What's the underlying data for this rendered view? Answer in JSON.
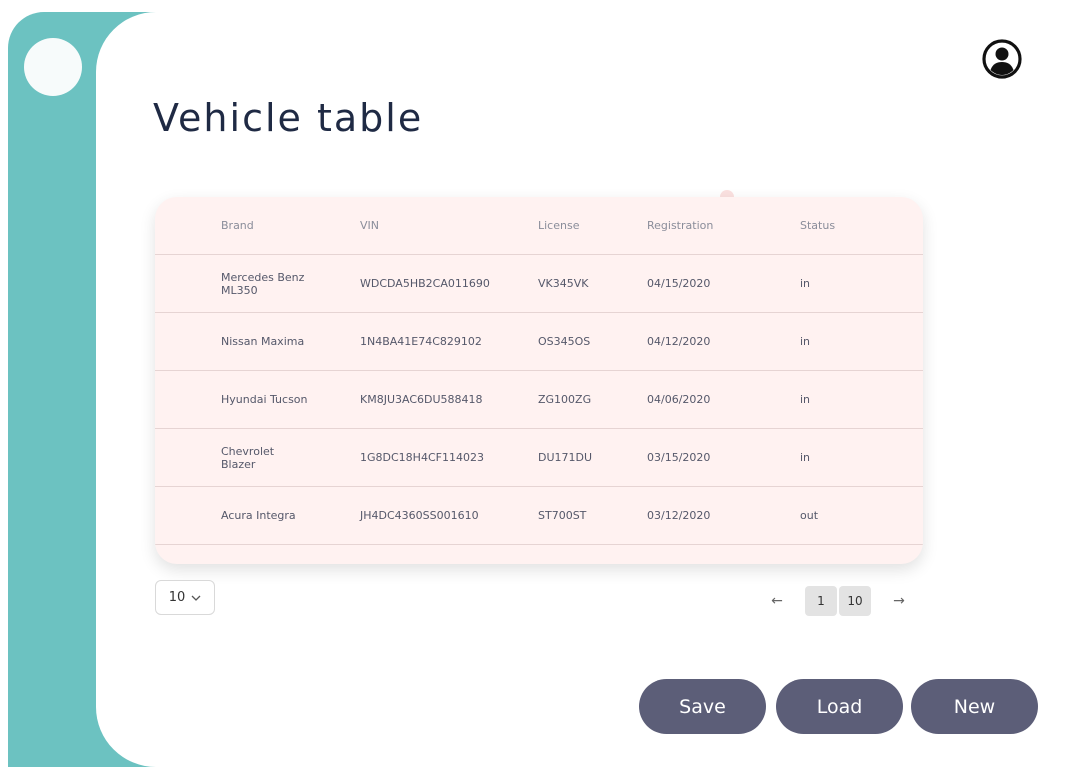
{
  "header": {
    "title": "Vehicle table",
    "profile_icon": "user-circle-icon"
  },
  "table": {
    "columns": [
      "Brand",
      "VIN",
      "License",
      "Registration",
      "Status"
    ],
    "rows": [
      {
        "brand": "Mercedes Benz ML350",
        "vin": "WDCDA5HB2CA011690",
        "license": "VK345VK",
        "registration": "04/15/2020",
        "status": "in"
      },
      {
        "brand": "Nissan Maxima",
        "vin": "1N4BA41E74C829102",
        "license": "OS345OS",
        "registration": "04/12/2020",
        "status": "in"
      },
      {
        "brand": "Hyundai Tucson",
        "vin": "KM8JU3AC6DU588418",
        "license": "ZG100ZG",
        "registration": "04/06/2020",
        "status": "in"
      },
      {
        "brand": "Chevrolet Blazer",
        "vin": "1G8DC18H4CF114023",
        "license": "DU171DU",
        "registration": "03/15/2020",
        "status": "in"
      },
      {
        "brand": "Acura Integra",
        "vin": "JH4DC4360SS001610",
        "license": "ST700ST",
        "registration": "03/12/2020",
        "status": "out"
      }
    ]
  },
  "pagination": {
    "page_size": "10",
    "pages": [
      "1",
      "10"
    ],
    "prev_arrow": "←",
    "next_arrow": "→"
  },
  "actions": {
    "save_label": "Save",
    "load_label": "Load",
    "new_label": "New"
  },
  "colors": {
    "teal": "#6cc2c1",
    "table_bg": "#fff2f1",
    "button": "#5c5e78",
    "title": "#1f2a44"
  }
}
